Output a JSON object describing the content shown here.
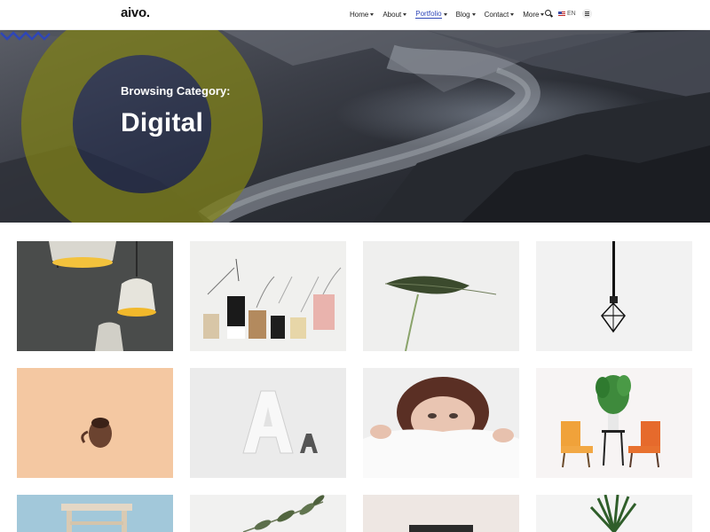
{
  "header": {
    "logo": "aivo.",
    "nav": [
      {
        "label": "Home",
        "active": false
      },
      {
        "label": "About",
        "active": false
      },
      {
        "label": "Portfolio",
        "active": true
      },
      {
        "label": "Blog",
        "active": false
      },
      {
        "label": "Contact",
        "active": false
      },
      {
        "label": "More",
        "active": false
      }
    ],
    "language": "EN",
    "icons": {
      "search": "search-icon",
      "menu": "hamburger-icon",
      "flag": "uk-flag-icon"
    }
  },
  "hero": {
    "subtitle": "Browsing Category:",
    "title": "Digital",
    "accent_color": "#8a8a1a",
    "wave_color": "#2e46b8"
  },
  "portfolio": [
    {
      "subject": "pendant lamps"
    },
    {
      "subject": "gift tags"
    },
    {
      "subject": "green leaf"
    },
    {
      "subject": "hanging light bulb"
    },
    {
      "subject": "coffee cup"
    },
    {
      "subject": "letter A"
    },
    {
      "subject": "woman under blanket"
    },
    {
      "subject": "chairs and plant"
    },
    {
      "subject": "wooden stool"
    },
    {
      "subject": "olive branch"
    },
    {
      "subject": "laptop"
    },
    {
      "subject": "potted palm"
    }
  ]
}
